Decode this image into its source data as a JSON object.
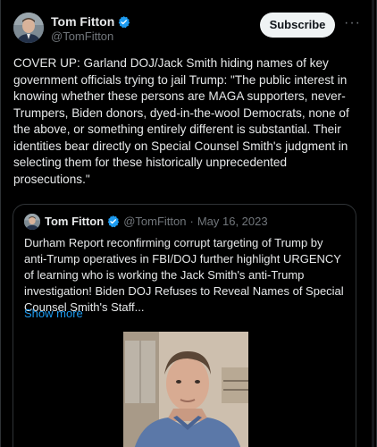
{
  "author": {
    "name": "Tom Fitton",
    "handle": "@TomFitton"
  },
  "actions": {
    "subscribe_label": "Subscribe",
    "more_label": "···"
  },
  "tweet": {
    "text": "COVER UP: Garland DOJ/Jack Smith hiding names of key government officials trying to jail Trump: \"The public interest in knowing whether these persons are MAGA supporters, never-Trumpers, Biden donors, dyed-in-the-wool Democrats, none of the above, or something entirely different is substantial. Their identities bear directly on Special Counsel Smith's judgment in selecting them for these historically unprecedented prosecutions.\""
  },
  "quote": {
    "name": "Tom Fitton",
    "handle": "@TomFitton",
    "separator": "·",
    "date": "May 16, 2023",
    "text": "Durham Report reconfirming corrupt targeting of Trump by anti-Trump operatives in FBI/DOJ further highlight URGENCY of learning who is working the Jack Smith's anti-Trump investigation!  Biden DOJ Refuses to Reveal Names of Special Counsel Smith's Staff...",
    "show_more": "Show more"
  },
  "colors": {
    "background": "#000000",
    "text": "#e7e9ea",
    "muted": "#71767b",
    "link": "#1d9bf0",
    "verified": "#1d9bf0",
    "border": "#2f3336"
  }
}
